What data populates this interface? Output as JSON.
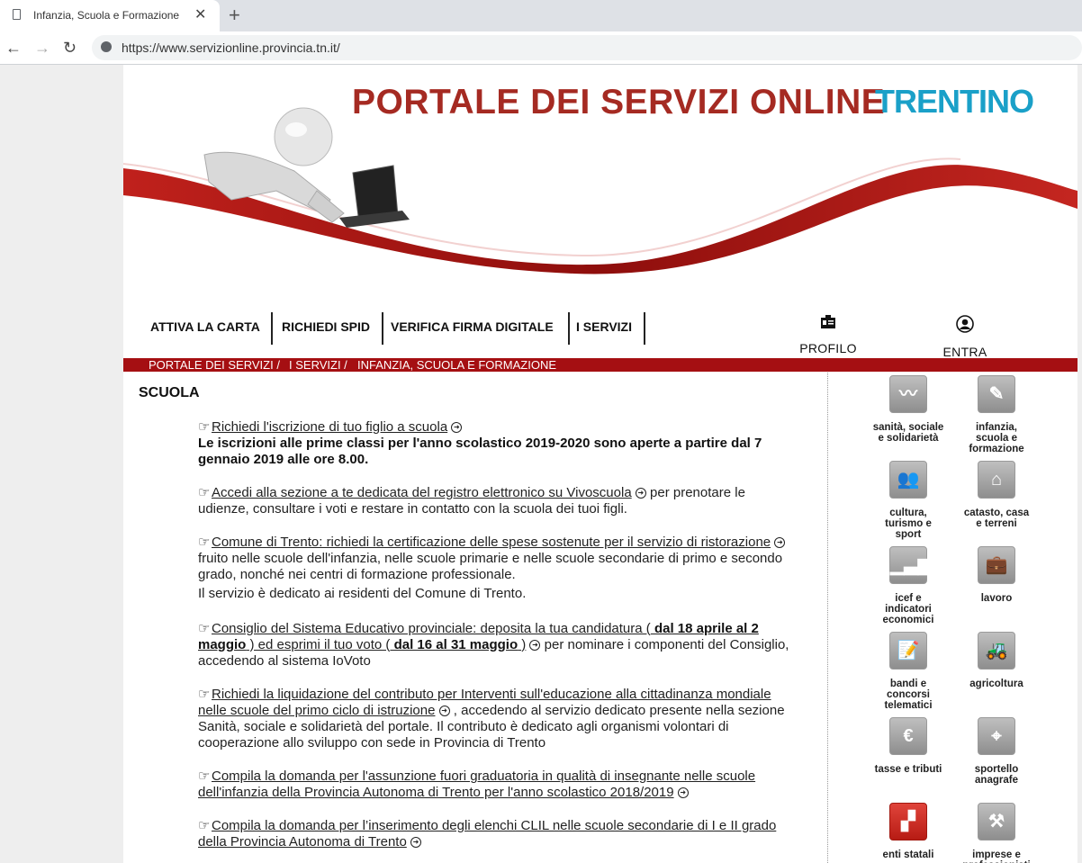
{
  "browser": {
    "tab_title": "Infanzia, Scuola e Formazione",
    "url": "https://www.servizionline.provincia.tn.it/"
  },
  "header": {
    "portal_title": "PORTALE DEI SERVIZI ONLINE",
    "logo_text": "TRENTINO"
  },
  "menu": {
    "items": [
      "ATTIVA LA CARTA",
      "RICHIEDI SPID",
      "VERIFICA FIRMA DIGITALE",
      "I SERVIZI"
    ],
    "profile_label": "PROFILO",
    "login_label": "ENTRA"
  },
  "breadcrumb": [
    "PORTALE DEI SERVIZI /",
    "I SERVIZI /",
    "INFANZIA, SCUOLA E FORMAZIONE"
  ],
  "section_title": "SCUOLA",
  "entries": [
    {
      "link": "Richiedi l'iscrizione di tuo figlio a scuola",
      "note": "Le iscrizioni alle prime classi per l'anno scolastico 2019-2020 sono aperte a partire dal 7 gennaio 2019 alle ore 8.00."
    },
    {
      "link": "Accedi alla sezione a te dedicata del registro elettronico su Vivoscuola",
      "text": " per prenotare le udienze, consultare i voti e restare in contatto con la scuola dei tuoi figli."
    },
    {
      "link": "Comune di Trento: richiedi la certificazione delle spese sostenute per il servizio di ristorazione",
      "text": " fruito nelle scuole dell'infanzia, nelle scuole primarie e nelle scuole secondarie di primo e secondo grado, nonché nei centri di formazione professionale.",
      "note": "Il servizio è dedicato ai residenti del Comune di Trento."
    },
    {
      "link_a": "Consiglio del Sistema Educativo provinciale: deposita la tua candidatura (",
      "bold_a": " dal 18 aprile al 2 maggio",
      "link_b": " ) ed esprimi il tuo voto (",
      "bold_b": " dal 16 al 31 maggio",
      "link_c": " )",
      "text": " per nominare i componenti del Consiglio, accedendo al sistema IoVoto"
    },
    {
      "link": "Richiedi la liquidazione del contributo per Interventi sull'educazione alla cittadinanza mondiale nelle scuole del primo ciclo di istruzione",
      "text": " , accedendo al servizio dedicato presente nella sezione Sanità, sociale e solidarietà del portale. Il contributo è dedicato agli organismi volontari di cooperazione allo sviluppo con sede in Provincia di Trento"
    },
    {
      "link": "Compila la domanda per l'assunzione fuori graduatoria in qualità di insegnante nelle scuole dell'infanzia della Provincia Autonoma di Trento per l'anno scolastico 2018/2019"
    },
    {
      "link": "Compila la domanda per l’inserimento degli elenchi CLIL nelle scuole secondarie di I e II grado della Provincia Autonoma di Trento"
    }
  ],
  "services": [
    {
      "label": "sanità, sociale e solidarietà",
      "icon": "heartbeat-icon"
    },
    {
      "label": "infanzia, scuola e formazione",
      "icon": "pencil-ruler-icon"
    },
    {
      "label": "cultura, turismo e sport",
      "icon": "people-icon"
    },
    {
      "label": "catasto, casa e terreni",
      "icon": "house-icon"
    },
    {
      "label": "icef e indicatori economici",
      "icon": "bar-chart-icon"
    },
    {
      "label": "lavoro",
      "icon": "briefcase-icon"
    },
    {
      "label": "bandi e concorsi telematici",
      "icon": "document-pen-icon"
    },
    {
      "label": "agricoltura",
      "icon": "tractor-icon"
    },
    {
      "label": "tasse e tributi",
      "icon": "euro-icon"
    },
    {
      "label": "sportello anagrafe",
      "icon": "map-pin-icon"
    },
    {
      "label": "enti statali",
      "icon": "italy-map-icon"
    },
    {
      "label": "imprese e professionisti",
      "icon": "tools-icon"
    }
  ]
}
